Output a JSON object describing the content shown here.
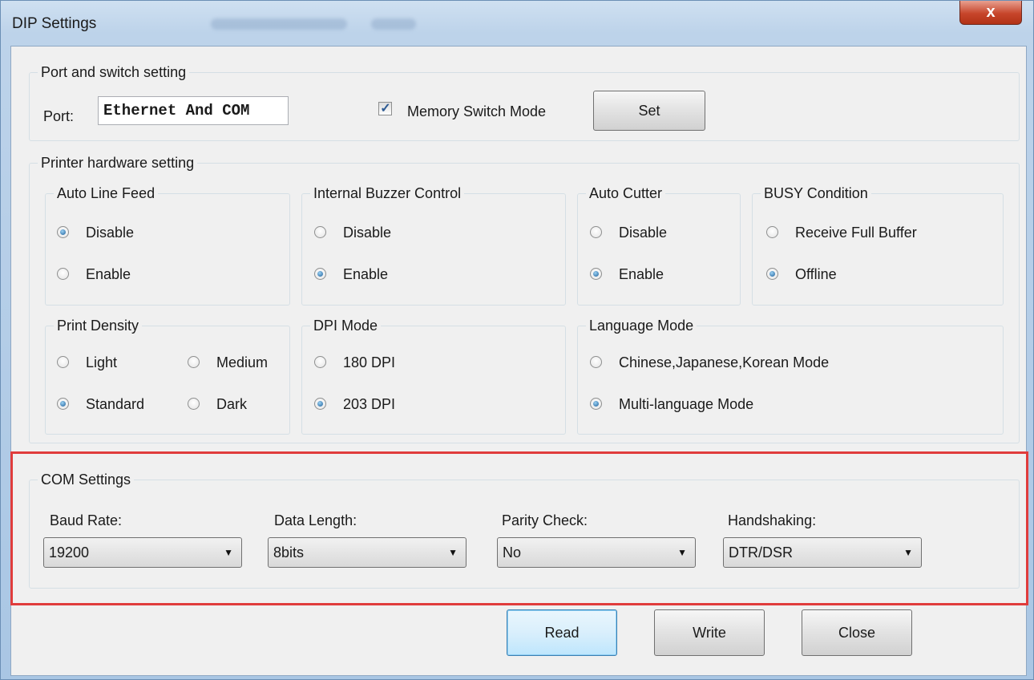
{
  "window": {
    "title": "DIP Settings",
    "close_glyph": "x",
    "blurred_menu": [
      "Select Language",
      "Help"
    ]
  },
  "port_switch": {
    "legend": "Port and switch setting",
    "port_label": "Port:",
    "port_value": "Ethernet And COM",
    "memory_switch_label": "Memory Switch Mode",
    "memory_switch_checked": true,
    "set_label": "Set"
  },
  "hardware": {
    "legend": "Printer hardware setting",
    "auto_line_feed": {
      "legend": "Auto Line Feed",
      "options": [
        "Disable",
        "Enable"
      ],
      "selected": "Disable"
    },
    "buzzer": {
      "legend": "Internal Buzzer Control",
      "options": [
        "Disable",
        "Enable"
      ],
      "selected": "Enable"
    },
    "auto_cutter": {
      "legend": "Auto Cutter",
      "options": [
        "Disable",
        "Enable"
      ],
      "selected": "Enable"
    },
    "busy": {
      "legend": "BUSY Condition",
      "options": [
        "Receive Full Buffer",
        "Offline"
      ],
      "selected": "Offline"
    },
    "print_density": {
      "legend": "Print Density",
      "options": [
        "Light",
        "Medium",
        "Standard",
        "Dark"
      ],
      "selected": "Standard"
    },
    "dpi_mode": {
      "legend": "DPI Mode",
      "options": [
        "180 DPI",
        "203 DPI"
      ],
      "selected": "203 DPI"
    },
    "language_mode": {
      "legend": "Language Mode",
      "options": [
        "Chinese,Japanese,Korean Mode",
        "Multi-language Mode"
      ],
      "selected": "Multi-language Mode"
    }
  },
  "com": {
    "legend": "COM Settings",
    "baud_label": "Baud Rate:",
    "baud_value": "19200",
    "data_length_label": "Data Length:",
    "data_length_value": "8bits",
    "parity_label": "Parity Check:",
    "parity_value": "No",
    "handshaking_label": "Handshaking:",
    "handshaking_value": "DTR/DSR"
  },
  "footer": {
    "read_label": "Read",
    "write_label": "Write",
    "close_label": "Close"
  },
  "icons": {
    "dropdown": "dropdown-arrow-icon",
    "check": "checkmark-icon"
  },
  "colors": {
    "highlight_border": "#e03c3c",
    "selected_radio": "#1d5f9a"
  }
}
